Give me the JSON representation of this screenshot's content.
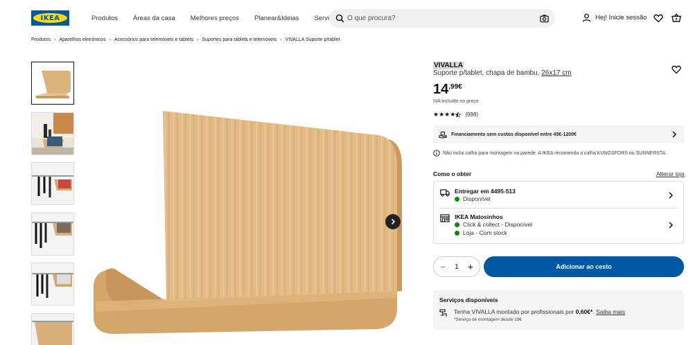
{
  "header": {
    "logo_text": "IKEA",
    "nav": [
      "Produtos",
      "Áreas da casa",
      "Melhores preços",
      "Planear&Ideias",
      "Serviços"
    ],
    "search_placeholder": "O que procura?",
    "login_label": "Hej! Inicie sessão"
  },
  "breadcrumb": [
    "Produtos",
    "Aparelhos eletrónicos",
    "Acessórios para telemóveis e tablets",
    "Suportes para tablets e telemóveis",
    "VIVALLA Suporte p/tablet"
  ],
  "product": {
    "brand": "VIVALLA",
    "description": "Suporte p/tablet, chapa de bambu,",
    "dimensions": "26x17 cm",
    "price_int": "14",
    "price_dec": ",99€",
    "vat_note": "IVA incluído no preço",
    "rating_stars": 4.5,
    "rating_count": "(998)"
  },
  "finance": {
    "label": "Financiamento sem custos disponível entre 45€-1200€"
  },
  "notice": "Não inclui calha para montagem na parede. A IKEA recomenda a calha KUNGSFORS ou SUNNERSTA.",
  "delivery": {
    "heading": "Como o obter",
    "change_link": "Alterar loja",
    "deliver_title": "Entregar em 4495-513",
    "deliver_status": "Disponível",
    "store_title": "IKEA Matosinhos",
    "store_status_1": "Click & collect - Disponível",
    "store_status_2": "Loja - Com stock"
  },
  "cart": {
    "quantity": "1",
    "add_label": "Adicionar ao cesto"
  },
  "services": {
    "title": "Serviços disponíveis",
    "line_prefix": "Tenha VIVALLA montado por profissionais por",
    "line_price": "0,60€*",
    "line_link": "Saiba mais",
    "note": "*Serviço de montagem desde 19€"
  },
  "colors": {
    "ikea_blue": "#0058a3",
    "ikea_yellow": "#ffdb00",
    "available_green": "#0a8a00"
  }
}
